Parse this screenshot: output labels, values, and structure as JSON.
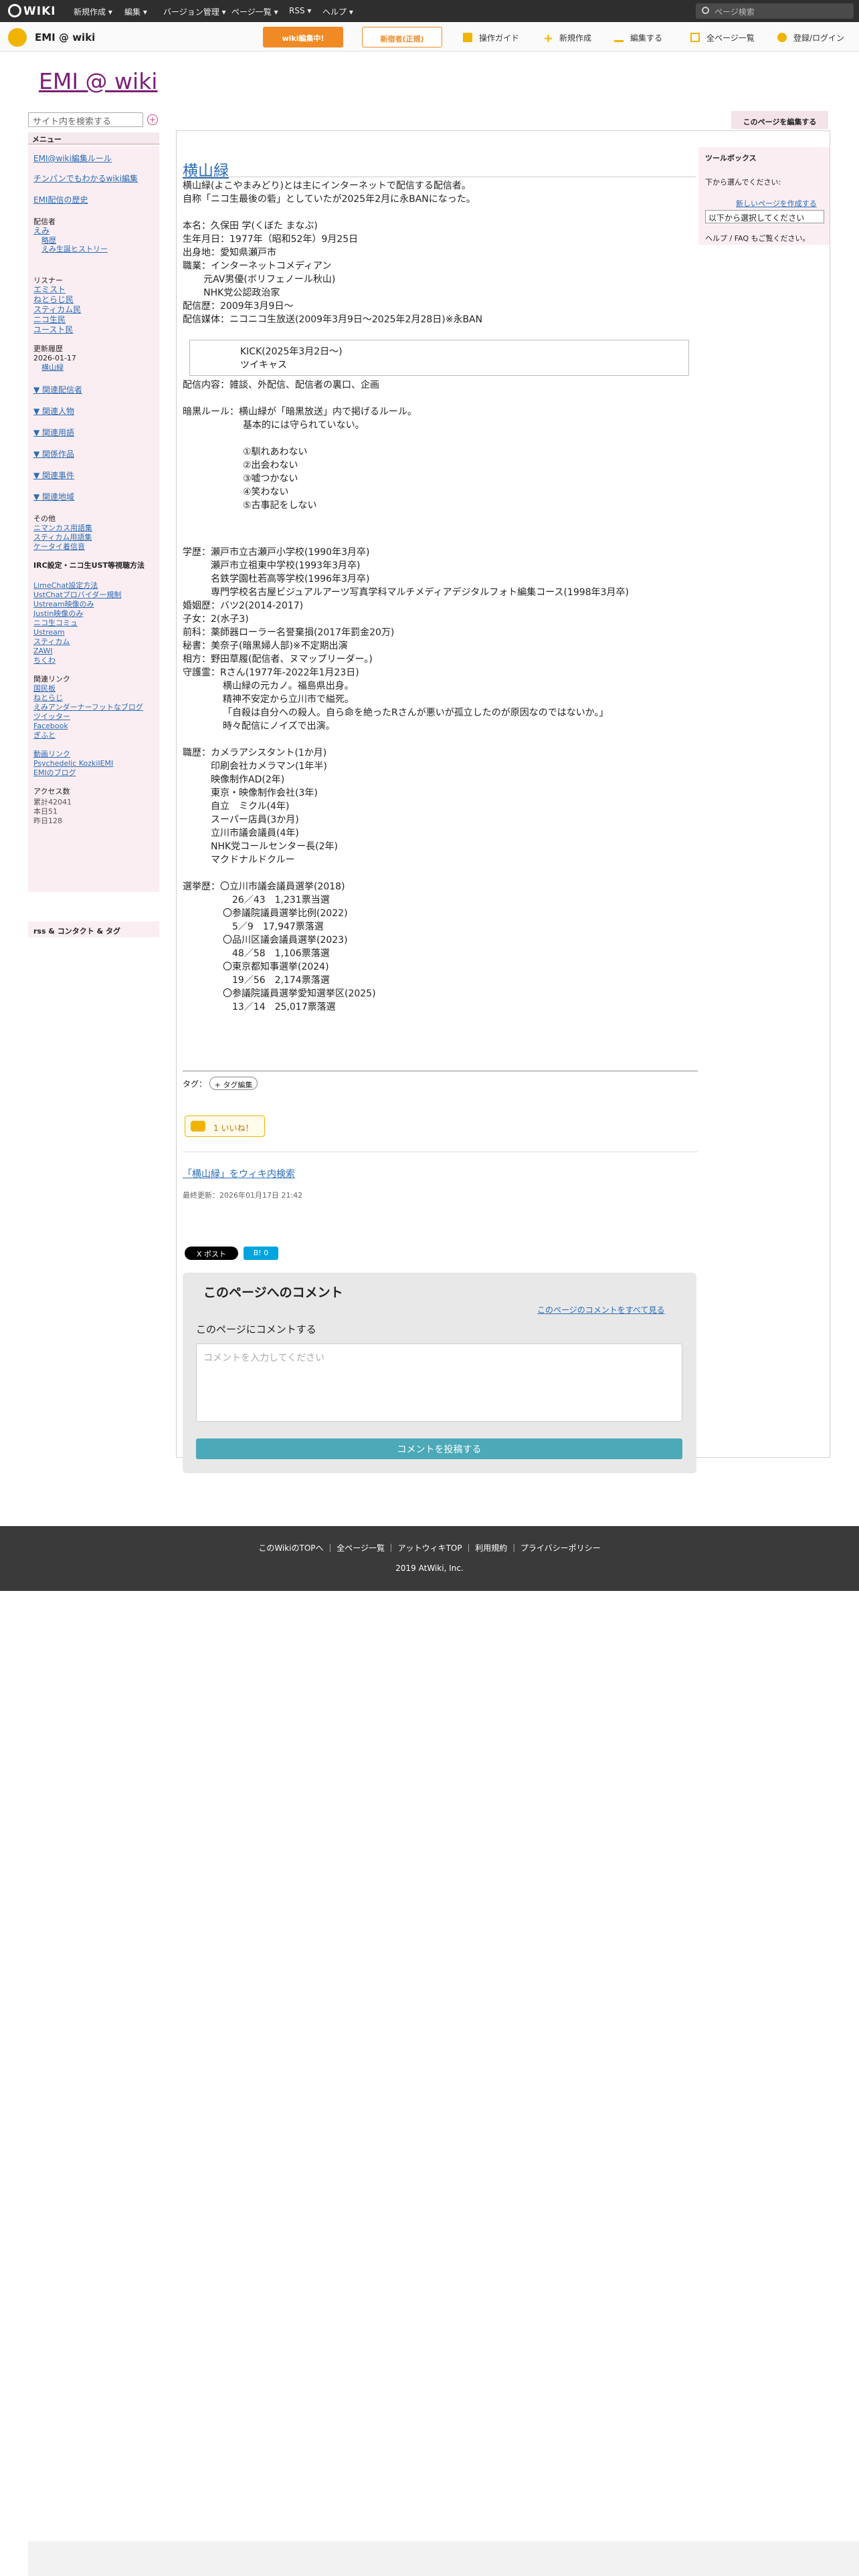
{
  "topbar": {
    "logo": "WIKI",
    "menus": [
      "新規作成 ▾",
      "編集 ▾",
      "バージョン管理 ▾",
      "ページ一覧 ▾",
      "RSS ▾",
      "ヘルプ ▾"
    ],
    "search_placeholder": "ページ検索"
  },
  "subbar": {
    "site_name": "EMI @ wiki",
    "btn_wiki": "wiki編集中!",
    "btn_ad": "新宿者(正規)",
    "tools": [
      "操作ガイド",
      "新規作成",
      "編集する",
      "全ページ一覧",
      "登録/ログイン"
    ]
  },
  "wiki_title": "EMI @ wiki",
  "sidebar": {
    "search_placeholder": "サイト内を検索する",
    "menu_label": "メニュー",
    "items": [
      "EMI@wiki編集ルール",
      "チンパンでもわかるwiki編集",
      "EMI配信の歴史",
      "配信者",
      "えみ",
      "略歴",
      "えみ生誕ヒストリー",
      "リスナー",
      "エミスト",
      "ねとらじ民",
      "スティカム民",
      "ニコ生民",
      "ユースト民",
      "更新履歴",
      "2026-01-17",
      "横山緑",
      "▼ 関連配信者",
      "▼ 関連人物",
      "▼ 関連用語",
      "▼ 関係作品",
      "▼ 関連事件",
      "▼ 関連地域",
      "その他",
      "ニマンカス用語集",
      "スティカム用語集",
      "ケータイ着信音",
      "IRC設定・ニコ生UST等視聴方法",
      "LimeChat設定方法",
      "UstChatプロバイダー規制",
      "Ustream映像のみ",
      "Justin映像のみ",
      "ニコ生コミュ",
      "Ustream",
      "スティカム",
      "ZAWI",
      "ちくわ",
      "関連リンク",
      "国民板",
      "ねとらじ",
      "えみアンダーナーフットなブログ",
      "ツイッター",
      "Facebook",
      "ぎふと",
      "動画リンク",
      "Psychedelic KozkilEMI",
      "EMIのブログ",
      "アクセス数",
      "累計42041",
      "本日51",
      "昨日128"
    ],
    "rss_label": "rss & コンタクト & タグ"
  },
  "edit_this_page": "このページを編集する",
  "page_title": "横山緑",
  "content_lines": [
    "横山緑(よこやまみどり)とは主にインターネットで配信する配信者。",
    "自称「ニコ生最後の砦」としていたが2025年2月に永BANになった。",
    "",
    "本名：久保田 学(くぼた まなぶ)",
    "生年月日：1977年（昭和52年）9月25日",
    "出身地：愛知県瀬戸市",
    "職業：インターネットコメディアン",
    "       元AV男優(ボリフェノール秋山)",
    "       NHK党公認政治家",
    "配信歴：2009年3月9日〜",
    "配信媒体：ニコニコ生放送(2009年3月9日〜2025年2月28日)※永BAN",
    "KICK(2025年3月2日〜)",
    "ツイキャス",
    "配信内容：雑談、外配信、配信者の裏口、企画",
    "暗黒ルール：横山緑が「暗黒放送」内で掲げるルール。",
    "基本的には守られていない。",
    "①馴れあわない",
    "②出会わない",
    "③嘘つかない",
    "④笑わない",
    "⑤古事記をしない",
    "学歴：瀬戸市立古瀬戸小学校(1990年3月卒)",
    "瀬戸市立祖東中学校(1993年3月卒)",
    "名鉄学園杜若高等学校(1996年3月卒)",
    "専門学校名古屋ビジュアルアーツ写真学科マルチメディアデジタルフォト編集コース(1998年3月卒)",
    "婚姻歴：バツ2(2014-2017)",
    "子女：2(水子3)",
    "前科：薬師器ローラー名誉棄損(2017年罰金20万)",
    "秘書：美奈子(暗黒婦人部)※不定期出演",
    "相方：野田草履(配信者、ヌマップリーダー。)",
    "守護霊：Rさん(1977年-2022年1月23日)",
    "横山緑の元カノ。福島県出身。",
    "精神不安定から立川市で縊死。",
    "「自殺は自分への殺人。自ら命を絶ったRさんが悪いが孤立したのが原因なのではないか。」",
    "時々配信にノイズで出演。",
    "職歴：カメラアシスタント(1か月)",
    "印刷会社カメラマン(1年半)",
    "映像制作AD(2年)",
    "東京・映像制作会社(3年)",
    "自立　ミクル(4年)",
    "スーパー店員(3か月)",
    "立川市議会議員(4年)",
    "NHK党コールセンター長(2年)",
    "マクドナルドクルー",
    "選挙歴：〇立川市議会議員選挙(2018)",
    "26／43　1,231票当選",
    "〇参議院議員選挙比例(2022)",
    "5／9　17,947票落選",
    "〇品川区議会議員選挙(2023)",
    "48／58　1,106票落選",
    "〇東京都知事選挙(2024)",
    "19／56　2,174票落選",
    "〇参議院議員選挙愛知選挙区(2025)",
    "13／14　25,017票落選"
  ],
  "tag_label": "タグ：",
  "tag_edit": "+ タグ編集",
  "iine": "1 いいね！",
  "wiki_search_link": "「横山緑」をウィキ内検索",
  "last_updated": "最終更新：2026年01月17日 21:42",
  "xpost": "X ポスト",
  "bpost": "B! 0",
  "comments": {
    "title": "このページへのコメント",
    "view_all": "このページのコメントをすべて見る",
    "label": "このページにコメントする",
    "placeholder": "コメントを入力してください",
    "submit": "コメントを投稿する"
  },
  "toolbox": {
    "title": "ツールボックス",
    "select_prompt": "下から選んでください:",
    "new_page": "新しいページを作成する",
    "select_value": "以下から選択してください",
    "help": "ヘルプ / FAQ もご覧ください。"
  },
  "footer": {
    "links": [
      "このWikiのTOPへ",
      "全ページ一覧",
      "アットウィキTOP",
      "利用規約",
      "プライバシーポリシー"
    ],
    "copyright": "2019 AtWiki, Inc."
  },
  "colors": {
    "accent": "#f0b400",
    "title_purple": "#7a1f76",
    "link": "#2a6cb5",
    "sidebar_bg": "#fbeef2"
  }
}
